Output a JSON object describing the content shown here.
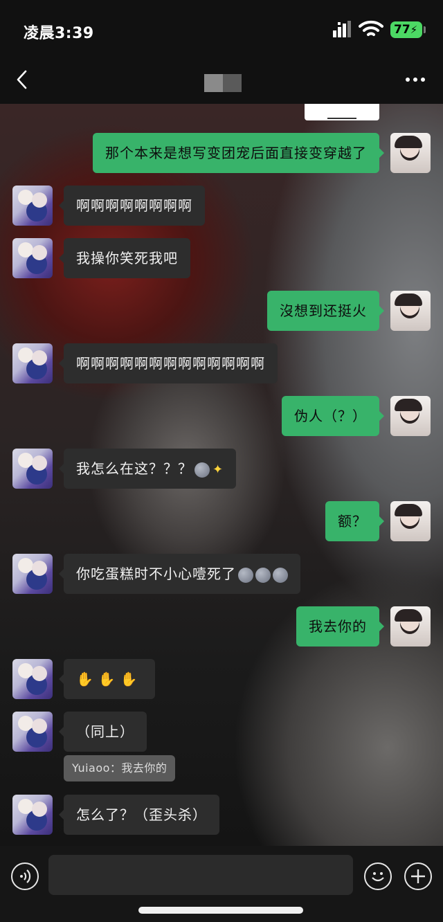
{
  "status_bar": {
    "time": "凌晨3:39",
    "battery": "77"
  },
  "header": {
    "title": ""
  },
  "messages": [
    {
      "side": "right",
      "text": "那个本来是想写变团宠后面直接变穿越了"
    },
    {
      "side": "left",
      "text": "啊啊啊啊啊啊啊啊"
    },
    {
      "side": "left",
      "text": "我操你笑死我吧"
    },
    {
      "side": "right",
      "text": "沒想到还挺火"
    },
    {
      "side": "left",
      "text": "啊啊啊啊啊啊啊啊啊啊啊啊啊"
    },
    {
      "side": "right",
      "text": "伪人（？）"
    },
    {
      "side": "left",
      "text": "我怎么在这？？？"
    },
    {
      "side": "right",
      "text": "额？"
    },
    {
      "side": "left",
      "text": "你吃蛋糕时不小心噎死了"
    },
    {
      "side": "right",
      "text": "我去你的"
    },
    {
      "side": "left",
      "text": ""
    },
    {
      "side": "left",
      "text": "（同上）"
    },
    {
      "side": "left",
      "text": "怎么了？（歪头杀）"
    }
  ],
  "quote": {
    "text": "Yuiaoo：我去你的"
  },
  "icons": [
    "back-icon",
    "more-icon",
    "signal-icon",
    "wifi-icon",
    "voice-icon",
    "emoji-icon",
    "plus-icon"
  ]
}
